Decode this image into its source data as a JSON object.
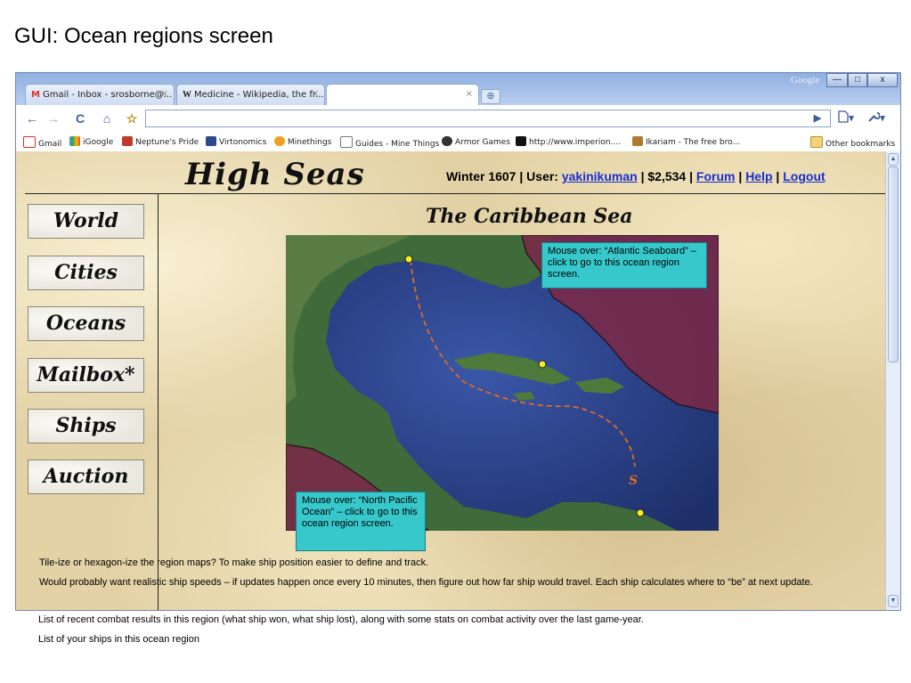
{
  "slide_title": "GUI: Ocean regions screen",
  "browser": {
    "tabs": [
      {
        "favicon": "M",
        "label": "Gmail - Inbox - srosborne@...",
        "close": "×"
      },
      {
        "favicon": "W",
        "label": "Medicine - Wikipedia, the fr...",
        "close": "×"
      },
      {
        "favicon": "",
        "label": "",
        "close": "×"
      }
    ],
    "new_tab": "⊕",
    "google_label": "Google",
    "window_buttons": {
      "minimize": "—",
      "maximize": "□",
      "close": "x"
    },
    "nav": {
      "back": "←",
      "forward": "→",
      "reload": "C",
      "home": "⌂",
      "star": "☆",
      "go": "▶",
      "page_menu": "▾",
      "tools_menu": "▾"
    },
    "address_value": "",
    "bookmarks": [
      {
        "label": "Gmail",
        "color": "#d93025"
      },
      {
        "label": "iGoogle",
        "color": "#4a8af4"
      },
      {
        "label": "Neptune's Pride",
        "color": "#c0392b"
      },
      {
        "label": "Virtonomics",
        "color": "#2c4a8c"
      },
      {
        "label": "Minethings",
        "color": "#f0a020"
      },
      {
        "label": "Guides - Mine Things",
        "color": "#ffffff"
      },
      {
        "label": "Armor Games",
        "color": "#333333"
      },
      {
        "label": "http://www.imperion....",
        "color": "#111111"
      },
      {
        "label": "Ikariam - The free bro...",
        "color": "#b07a30"
      }
    ],
    "other_bookmarks": "Other bookmarks"
  },
  "site": {
    "logo": "High Seas",
    "season": "Winter 1607",
    "user_label": "User:",
    "username": "yakinikuman",
    "money": "$2,534",
    "sep": "|",
    "links": {
      "forum": "Forum",
      "help": "Help",
      "logout": "Logout"
    },
    "nav": [
      "World",
      "Cities",
      "Oceans",
      "Mailbox*",
      "Ships",
      "Auction"
    ],
    "region_title": "The Caribbean Sea",
    "ship_label": "S"
  },
  "callouts": {
    "atlantic": "Mouse over: “Atlantic Seaboard” – click to go to this ocean region screen.",
    "pacific": "Mouse over: “North Pacific Ocean” – click to go to this ocean region screen."
  },
  "notes": {
    "line1": "Tile-ize or hexagon-ize the region maps?  To make ship position easier to define and track.",
    "line2": "Would probably want realistic ship speeds – if updates happen once every 10 minutes, then figure out how far ship would travel.  Each ship calculates where to “be” at next update.",
    "line3": "List of recent combat results in this region (what ship won, what ship lost), along with some stats on combat activity over the last game-year.",
    "line4": "List of your ships in this ocean region"
  },
  "colors": {
    "link": "#1a2fcf",
    "callout": "#36c8cb",
    "parchment": "#e3d2a6",
    "ocean": "#2a3f86",
    "region_highlight": "#7a2a48"
  }
}
